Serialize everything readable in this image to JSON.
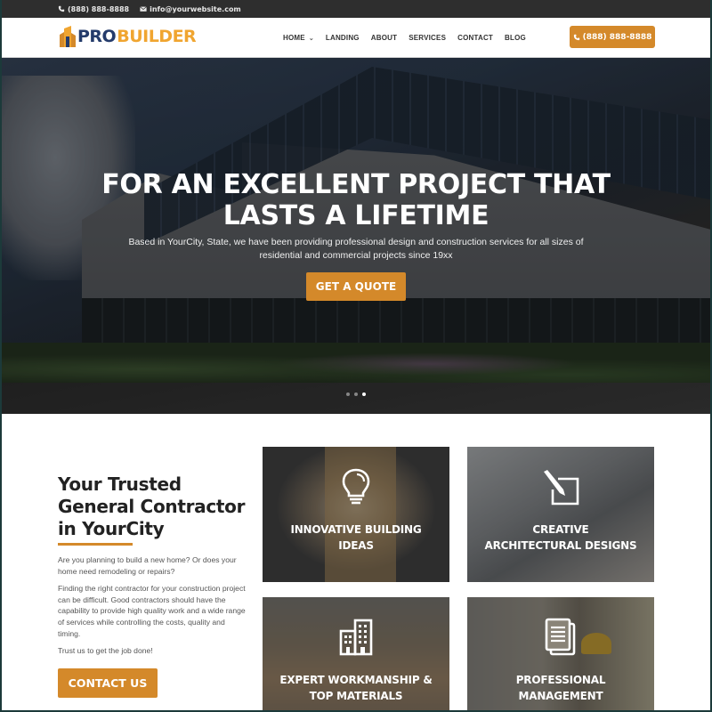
{
  "topbar": {
    "phone": "(888) 888-8888",
    "email": "info@yourwebsite.com"
  },
  "header": {
    "logo": {
      "part1": "PRO",
      "part2": "BUILDER"
    },
    "nav": [
      {
        "label": "HOME",
        "has_dropdown": true
      },
      {
        "label": "LANDING"
      },
      {
        "label": "ABOUT"
      },
      {
        "label": "SERVICES"
      },
      {
        "label": "CONTACT"
      },
      {
        "label": "BLOG"
      }
    ],
    "phone_button": "(888) 888-8888"
  },
  "hero": {
    "title_line1": "FOR AN EXCELLENT PROJECT THAT",
    "title_line2": "LASTS A LIFETIME",
    "subtitle": "Based in YourCity, State, we have been providing professional design and construction services for all sizes of residential and commercial projects since 19xx",
    "cta": "GET A QUOTE",
    "slides": 3,
    "active_slide": 3
  },
  "about": {
    "title_line1": "Your Trusted",
    "title_line2": "General Contractor",
    "title_line3": "in YourCity",
    "paragraphs": [
      "Are you planning to build a new home? Or does your home need remodeling or repairs?",
      "Finding the right contractor for your construction project can be difficult. Good contractors should have the capability to provide high quality work and a wide range of services while controlling the costs, quality and timing.",
      "Trust us to get the job done!"
    ],
    "cta": "CONTACT US"
  },
  "services": [
    {
      "icon": "lightbulb-icon",
      "line1": "INNOVATIVE BUILDING",
      "line2": "IDEAS"
    },
    {
      "icon": "pencil-square-icon",
      "line1": "CREATIVE",
      "line2": "ARCHITECTURAL DESIGNS"
    },
    {
      "icon": "buildings-icon",
      "line1": "EXPERT WORKMANSHIP &",
      "line2": "TOP MATERIALS"
    },
    {
      "icon": "documents-icon",
      "line1": "PROFESSIONAL",
      "line2": "MANAGEMENT"
    }
  ],
  "colors": {
    "accent": "#d4892a",
    "topbar": "#2e2e2e",
    "logo_navy": "#243b6b",
    "logo_orange": "#f0a530"
  }
}
